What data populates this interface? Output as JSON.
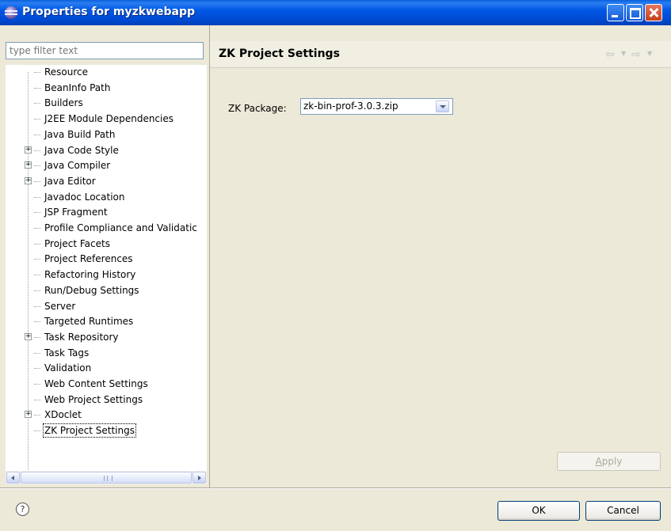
{
  "window": {
    "title": "Properties for myzkwebapp"
  },
  "filter": {
    "placeholder": "type filter text"
  },
  "tree": {
    "items": [
      {
        "label": "Resource",
        "expandable": false,
        "expander": ""
      },
      {
        "label": "BeanInfo Path",
        "expandable": false,
        "expander": ""
      },
      {
        "label": "Builders",
        "expandable": false,
        "expander": ""
      },
      {
        "label": "J2EE Module Dependencies",
        "expandable": false,
        "expander": ""
      },
      {
        "label": "Java Build Path",
        "expandable": false,
        "expander": ""
      },
      {
        "label": "Java Code Style",
        "expandable": true,
        "expander": "+"
      },
      {
        "label": "Java Compiler",
        "expandable": true,
        "expander": "+"
      },
      {
        "label": "Java Editor",
        "expandable": true,
        "expander": "+"
      },
      {
        "label": "Javadoc Location",
        "expandable": false,
        "expander": ""
      },
      {
        "label": "JSP Fragment",
        "expandable": false,
        "expander": ""
      },
      {
        "label": "Profile Compliance and Validatic",
        "expandable": false,
        "expander": ""
      },
      {
        "label": "Project Facets",
        "expandable": false,
        "expander": ""
      },
      {
        "label": "Project References",
        "expandable": false,
        "expander": ""
      },
      {
        "label": "Refactoring History",
        "expandable": false,
        "expander": ""
      },
      {
        "label": "Run/Debug Settings",
        "expandable": false,
        "expander": ""
      },
      {
        "label": "Server",
        "expandable": false,
        "expander": ""
      },
      {
        "label": "Targeted Runtimes",
        "expandable": false,
        "expander": ""
      },
      {
        "label": "Task Repository",
        "expandable": true,
        "expander": "+"
      },
      {
        "label": "Task Tags",
        "expandable": false,
        "expander": ""
      },
      {
        "label": "Validation",
        "expandable": false,
        "expander": ""
      },
      {
        "label": "Web Content Settings",
        "expandable": false,
        "expander": ""
      },
      {
        "label": "Web Project Settings",
        "expandable": false,
        "expander": ""
      },
      {
        "label": "XDoclet",
        "expandable": true,
        "expander": "+"
      },
      {
        "label": "ZK Project Settings",
        "expandable": false,
        "expander": "",
        "selected": true
      }
    ],
    "scroll_grip": "III"
  },
  "page": {
    "title": "ZK Project Settings",
    "back_icon": "⇦",
    "forward_icon": "⇨",
    "dropdown_glyph": "▼",
    "zk_package_label": "ZK Package:",
    "zk_package_value": "zk-bin-prof-3.0.3.zip",
    "apply_label_prefix": "",
    "apply_label_underlined": "A",
    "apply_label_rest": "pply"
  },
  "footer": {
    "help_glyph": "?",
    "ok_label": "OK",
    "cancel_label": "Cancel"
  },
  "colors": {
    "titlebar": "#0058E6",
    "dialog_bg": "#ECE9D8",
    "header_bg": "#F1EFE2",
    "button_border": "#003C74"
  },
  "icons": {
    "title": "eclipse-icon",
    "help": "help-icon",
    "expander": "expand-plus-icon"
  }
}
